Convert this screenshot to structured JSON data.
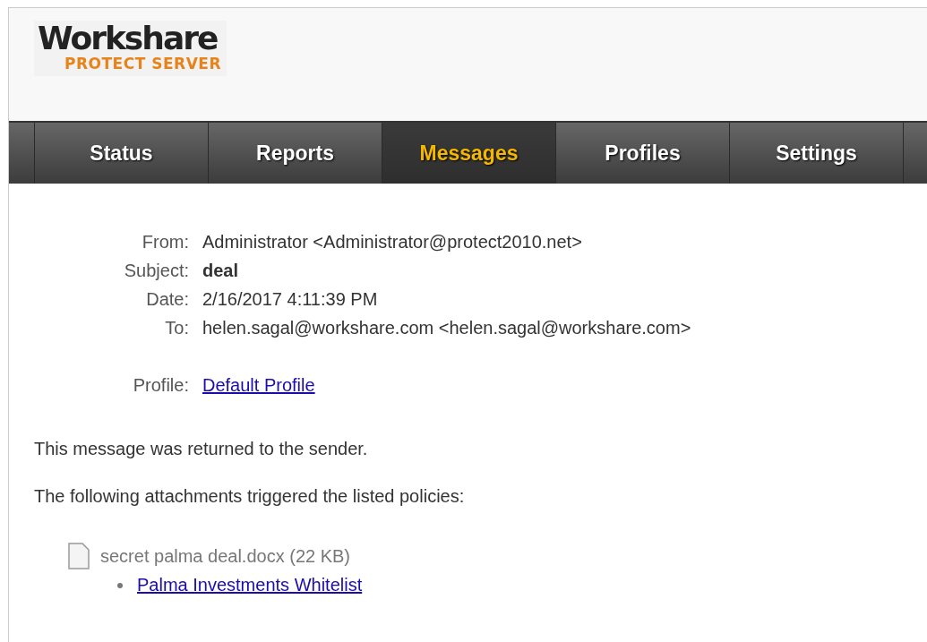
{
  "logo": {
    "name": "Workshare",
    "subtitle": "PROTECT SERVER"
  },
  "tabs": [
    {
      "label": "Status",
      "selected": false
    },
    {
      "label": "Reports",
      "selected": false
    },
    {
      "label": "Messages",
      "selected": true
    },
    {
      "label": "Profiles",
      "selected": false
    },
    {
      "label": "Settings",
      "selected": false
    }
  ],
  "headers": [
    {
      "label": "From:",
      "value": "Administrator <Administrator@protect2010.net>",
      "kind": "plain"
    },
    {
      "label": "Subject:",
      "value": "deal",
      "kind": "bold"
    },
    {
      "label": "Date:",
      "value": "2/16/2017 4:11:39 PM",
      "kind": "plain"
    },
    {
      "label": "To:",
      "value": "helen.sagal@workshare.com <helen.sagal@workshare.com>",
      "kind": "plain"
    }
  ],
  "profile": {
    "label": "Profile:",
    "value": "Default Profile"
  },
  "paragraphs": [
    "This message was returned to the sender.",
    "The following attachments triggered the listed policies:"
  ],
  "attachments": [
    {
      "name": "secret palma deal.docx (22 KB)",
      "policies": [
        "Palma Investments Whitelist"
      ]
    }
  ]
}
